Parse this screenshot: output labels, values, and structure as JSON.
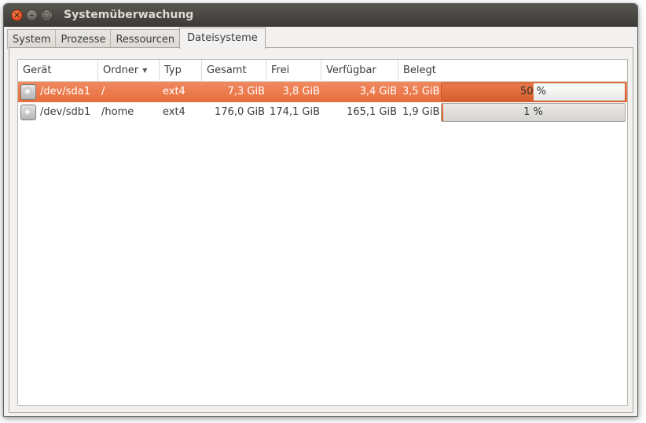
{
  "window": {
    "title": "Systemüberwachung"
  },
  "tabs": [
    {
      "label": "System",
      "active": false
    },
    {
      "label": "Prozesse",
      "active": false
    },
    {
      "label": "Ressourcen",
      "active": false
    },
    {
      "label": "Dateisysteme",
      "active": true
    }
  ],
  "table": {
    "columns": [
      "Gerät",
      "Ordner",
      "Typ",
      "Gesamt",
      "Frei",
      "Verfügbar",
      "Belegt"
    ],
    "sorted_column": "Ordner",
    "rows": [
      {
        "device": "/dev/sda1",
        "folder": "/",
        "type": "ext4",
        "total": "7,3 GiB",
        "free": "3,8 GiB",
        "available": "3,4 GiB",
        "used": "3,5 GiB",
        "percent_text": "50 %",
        "percent_value": 50,
        "selected": true,
        "icon": "harddisk-icon"
      },
      {
        "device": "/dev/sdb1",
        "folder": "/home",
        "type": "ext4",
        "total": "176,0 GiB",
        "free": "174,1 GiB",
        "available": "165,1 GiB",
        "used": "1,9 GiB",
        "percent_text": "1 %",
        "percent_value": 1,
        "selected": false,
        "icon": "harddisk-icon"
      }
    ]
  },
  "colors": {
    "selection": "#e97a4a",
    "titlebar": "#3c3b37",
    "close_button": "#e2561f"
  }
}
